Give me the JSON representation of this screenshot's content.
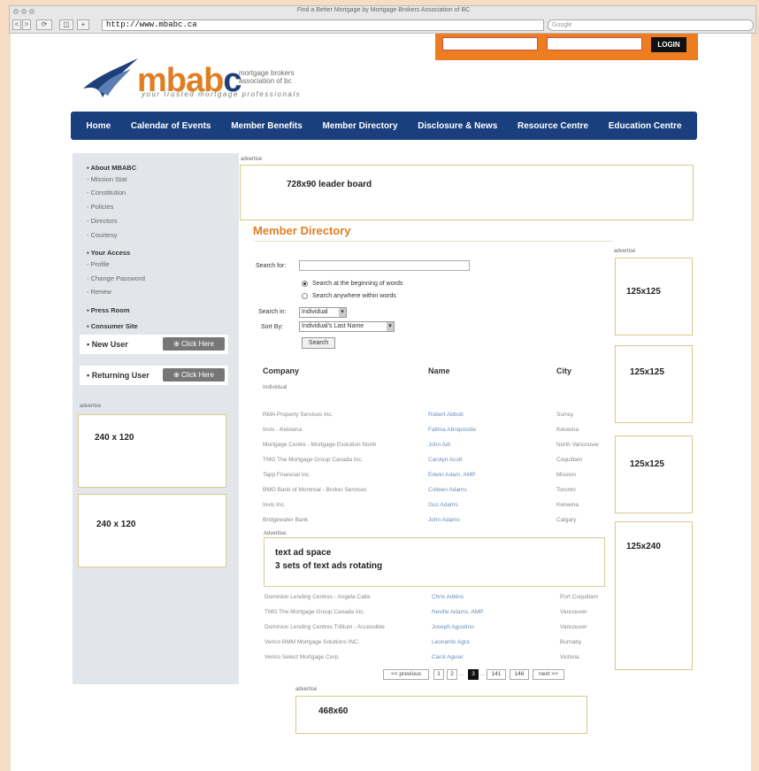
{
  "browser": {
    "window_title": "Find a Better Mortgage by Mortgage Brokers Association of BC",
    "url": "http://www.mbabc.ca",
    "search_placeholder": "Google",
    "buttons": [
      "<",
      ">",
      "⟳",
      "+"
    ]
  },
  "header": {
    "login_button": "LOGIN",
    "logo_word_1": "mbab",
    "logo_word_2": "c",
    "logo_subtitle": "mortgage brokers association of bc",
    "logo_tagline": "your trusted mortgage professionals"
  },
  "nav": [
    "Home",
    "Calendar of Events",
    "Member Benefits",
    "Member Directory",
    "Disclosure & News",
    "Resource Centre",
    "Education Centre"
  ],
  "sidebar": {
    "about_heading": "About MBABC",
    "about_items": [
      "Mission Stat",
      "Constitution",
      "Policies",
      "Directors",
      "Courtesy"
    ],
    "access_heading": "Your Access",
    "access_items": [
      "Profile",
      "Change Password",
      "Renew"
    ],
    "press_room": "Press Room",
    "consumer_site": "Consumer Site",
    "new_user": "New User",
    "returning_user": "Returning User",
    "click_here": "Click Here",
    "ad_label": "advertise",
    "ad1": "240 x 120",
    "ad2": "240 x 120"
  },
  "leaderboard": {
    "label": "advertise",
    "text": "728x90 leader board"
  },
  "directory": {
    "title": "Member Directory",
    "search_for_label": "Search for:",
    "radio_1": "Search at the beginning of words",
    "radio_2": "Search anywhere within words",
    "search_in_label": "Search in:",
    "search_in_value": "Individual",
    "sort_by_label": "Sort By:",
    "sort_by_value": "Individual's Last Name",
    "search_button": "Search",
    "col_company": "Company",
    "col_name": "Name",
    "col_city": "City",
    "subhead": "Individual",
    "rows_1": [
      [
        "RMA Property Services Inc.",
        "Robert Abbott",
        "Surrey"
      ],
      [
        "Invis - Kelowna",
        "Fatima Abraposide",
        "Kelowna"
      ],
      [
        "Mortgage Centre - Mortgage Evolution North",
        "John Adl",
        "North Vancouver"
      ],
      [
        "TMG The Mortgage Group Canada Inc.",
        "Carolyn Acott",
        "Coquitlam"
      ],
      [
        "Tapp Financial Inc.",
        "Edwin Adam, AMP",
        "Mission"
      ],
      [
        "BMO Bank of Montreal - Broker Services",
        "Colleen Adams",
        "Toronto"
      ],
      [
        "Invis Inc.",
        "Gus Adams",
        "Kelowna"
      ],
      [
        "Bridgewater Bank",
        "John Adams",
        "Calgary"
      ]
    ],
    "text_ad_label": "Advertise:",
    "text_ad_line1": "text ad space",
    "text_ad_line2": "3 sets of text ads rotating",
    "rows_2": [
      [
        "Dominion Lending Centres - Angela Calla",
        "Chris Adkins",
        "Port Coquitlam"
      ],
      [
        "TMG The Mortgage Group Canada Inc.",
        "Neville Adams, AMP",
        "Vancouver"
      ],
      [
        "Dominion Lending Centres Trillium - Accessible",
        "Joseph Agostino",
        "Vancouver"
      ],
      [
        "Verico BMM Mortgage Solutions INC.",
        "Leonardo Agra",
        "Burnaby"
      ],
      [
        "Verico Select Mortgage Corp.",
        "Carol Aguiar",
        "Victoria"
      ]
    ],
    "pagination": [
      "<< previous",
      "1",
      "2",
      "...",
      "3",
      "...",
      "141",
      "146",
      "next >>"
    ]
  },
  "right_ads": {
    "label": "advertise",
    "ad1": "125x125",
    "ad2": "125x125",
    "ad3": "125x125",
    "ad4": "125x240"
  },
  "bottom_ad": {
    "label": "advertise",
    "text": "468x60"
  }
}
